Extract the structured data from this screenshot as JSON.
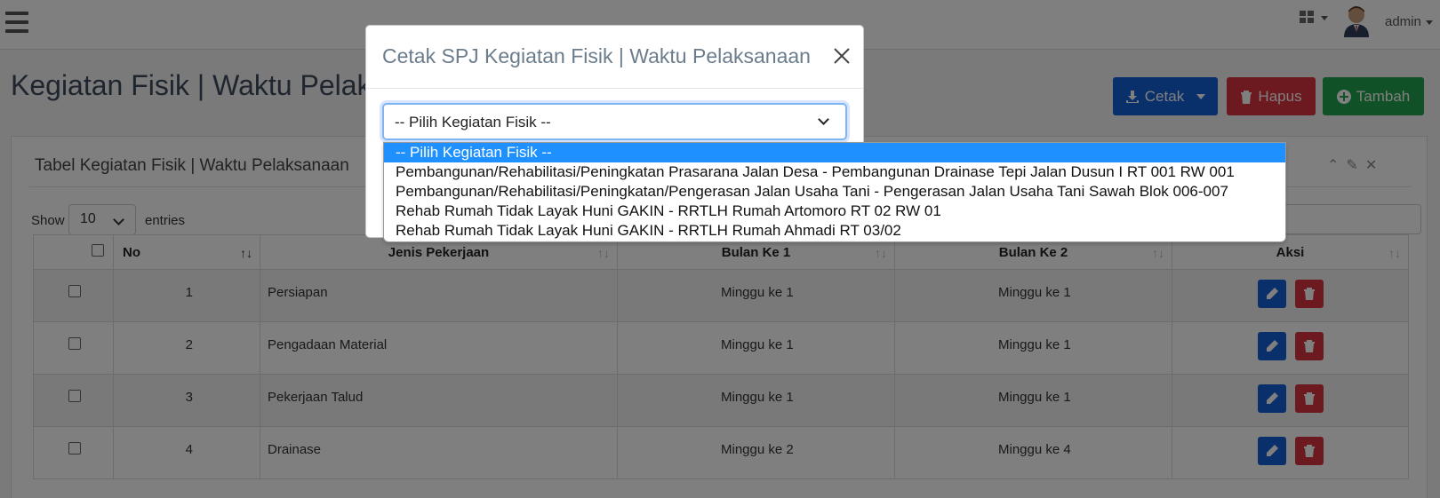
{
  "navbar": {
    "user": "admin"
  },
  "page": {
    "title": "Kegiatan Fisik | Waktu Pelaksanaan"
  },
  "buttons": {
    "cetak": "Cetak",
    "hapus": "Hapus",
    "tambah": "Tambah"
  },
  "panel": {
    "title": "Tabel Kegiatan Fisik | Waktu Pelaksanaan"
  },
  "entries": {
    "show": "Show",
    "value": "10",
    "suffix": "entries"
  },
  "table": {
    "headers": {
      "no": "No",
      "jenis": "Jenis Pekerjaan",
      "bulan1": "Bulan Ke 1",
      "bulan2": "Bulan Ke 2",
      "aksi": "Aksi"
    },
    "rows": [
      {
        "no": "1",
        "jenis": "Persiapan",
        "bulan1": "Minggu ke 1",
        "bulan2": "Minggu ke 1"
      },
      {
        "no": "2",
        "jenis": "Pengadaan Material",
        "bulan1": "Minggu ke 1",
        "bulan2": "Minggu ke 1"
      },
      {
        "no": "3",
        "jenis": "Pekerjaan Talud",
        "bulan1": "Minggu ke 1",
        "bulan2": "Minggu ke 1"
      },
      {
        "no": "4",
        "jenis": "Drainase",
        "bulan1": "Minggu ke 2",
        "bulan2": "Minggu ke 4"
      }
    ]
  },
  "modal": {
    "title": "Cetak SPJ Kegiatan Fisik | Waktu Pelaksanaan",
    "select_value": "-- Pilih Kegiatan Fisik --",
    "options": [
      "-- Pilih Kegiatan Fisik --",
      "Pembangunan/Rehabilitasi/Peningkatan Prasarana Jalan Desa - Pembangunan Drainase Tepi Jalan Dusun I RT 001 RW 001",
      "Pembangunan/Rehabilitasi/Peningkatan/Pengerasan Jalan Usaha Tani - Pengerasan Jalan Usaha Tani Sawah Blok 006-007",
      "Rehab Rumah Tidak Layak Huni GAKIN - RRTLH Rumah Artomoro RT 02 RW 01",
      "Rehab Rumah Tidak Layak Huni GAKIN - RRTLH Rumah Ahmadi RT 03/02"
    ]
  },
  "colors": {
    "primary": "#1460d6",
    "danger": "#d9353f",
    "success": "#22a34f",
    "highlight": "#1e90ff"
  }
}
